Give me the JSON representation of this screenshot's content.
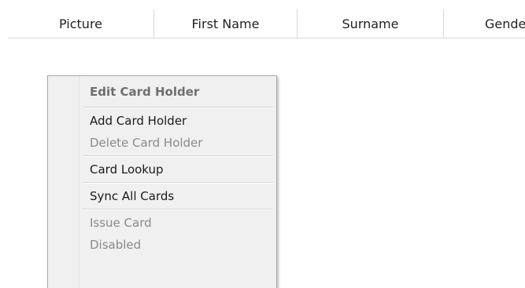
{
  "table": {
    "columns": [
      "Picture",
      "First Name",
      "Surname",
      "Gender"
    ]
  },
  "context_menu": {
    "header": "Edit Card Holder",
    "items": [
      {
        "label": "Add Card Holder",
        "enabled": true
      },
      {
        "label": "Delete Card Holder",
        "enabled": false
      },
      {
        "label": "Card Lookup",
        "enabled": true
      },
      {
        "label": "Sync All Cards",
        "enabled": true
      },
      {
        "label": "Issue Card",
        "enabled": false
      },
      {
        "label": "Disabled",
        "enabled": false
      }
    ]
  }
}
